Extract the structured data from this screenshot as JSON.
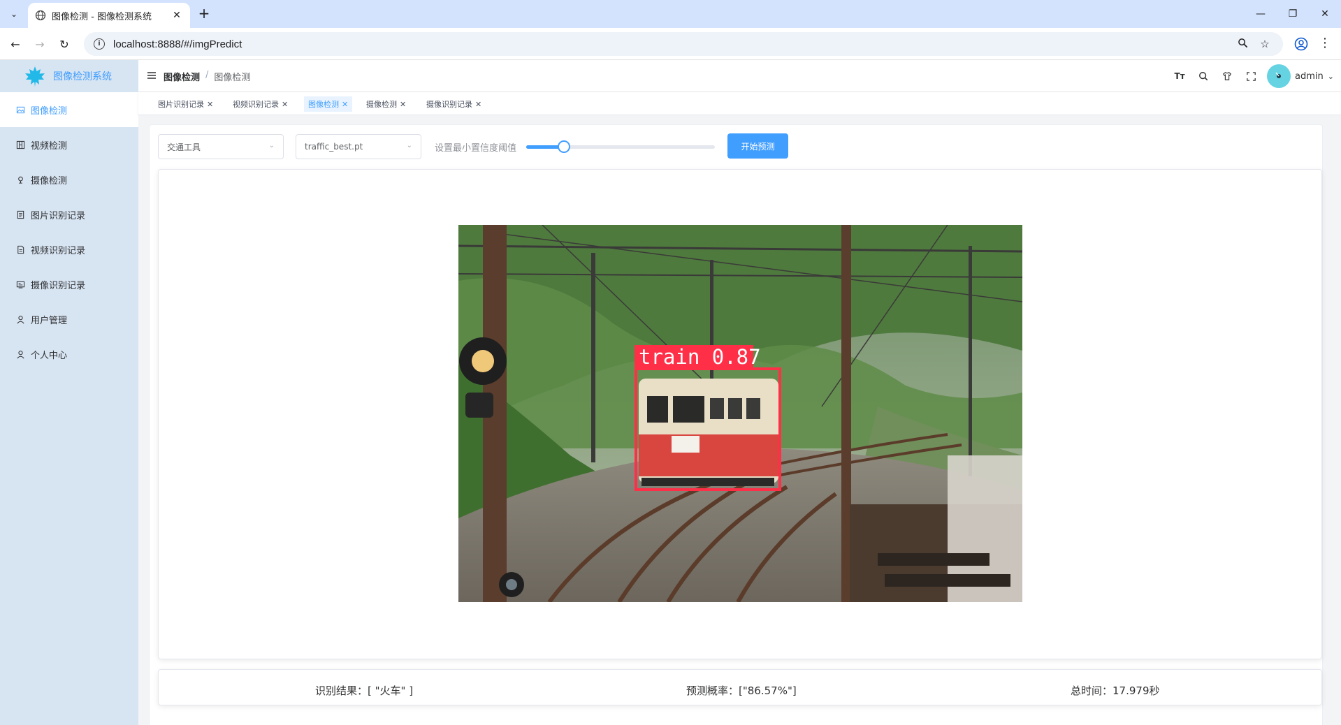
{
  "browser": {
    "tab_title": "图像检测 - 图像检测系统",
    "url": "localhost:8888/#/imgPredict"
  },
  "app": {
    "name": "图像检测系统",
    "accent_color": "#409eff"
  },
  "sidebar": {
    "items": [
      {
        "label": "图像检测",
        "icon": "image-icon",
        "active": true
      },
      {
        "label": "视频检测",
        "icon": "video-icon"
      },
      {
        "label": "摄像检测",
        "icon": "camera-icon"
      },
      {
        "label": "图片识别记录",
        "icon": "document-icon"
      },
      {
        "label": "视频识别记录",
        "icon": "document-icon"
      },
      {
        "label": "摄像识别记录",
        "icon": "monitor-icon"
      },
      {
        "label": "用户管理",
        "icon": "user-icon"
      },
      {
        "label": "个人中心",
        "icon": "user-icon"
      }
    ]
  },
  "header": {
    "breadcrumb": [
      "图像检测",
      "图像检测"
    ],
    "username": "admin"
  },
  "tags": [
    {
      "label": "图片识别记录"
    },
    {
      "label": "视频识别记录"
    },
    {
      "label": "图像检测",
      "active": true
    },
    {
      "label": "摄像检测"
    },
    {
      "label": "摄像识别记录"
    }
  ],
  "controls": {
    "category_select": "交通工具",
    "model_select": "traffic_best.pt",
    "threshold_label": "设置最小置信度阈值",
    "threshold_value": 0.2,
    "predict_button": "开始预测"
  },
  "detection": {
    "label": "train 0.87"
  },
  "results": {
    "recognition": "识别结果：[ \"火车\" ]",
    "probability": "预测概率：[\"86.57%\"]",
    "total_time": "总时间：17.979秒"
  }
}
